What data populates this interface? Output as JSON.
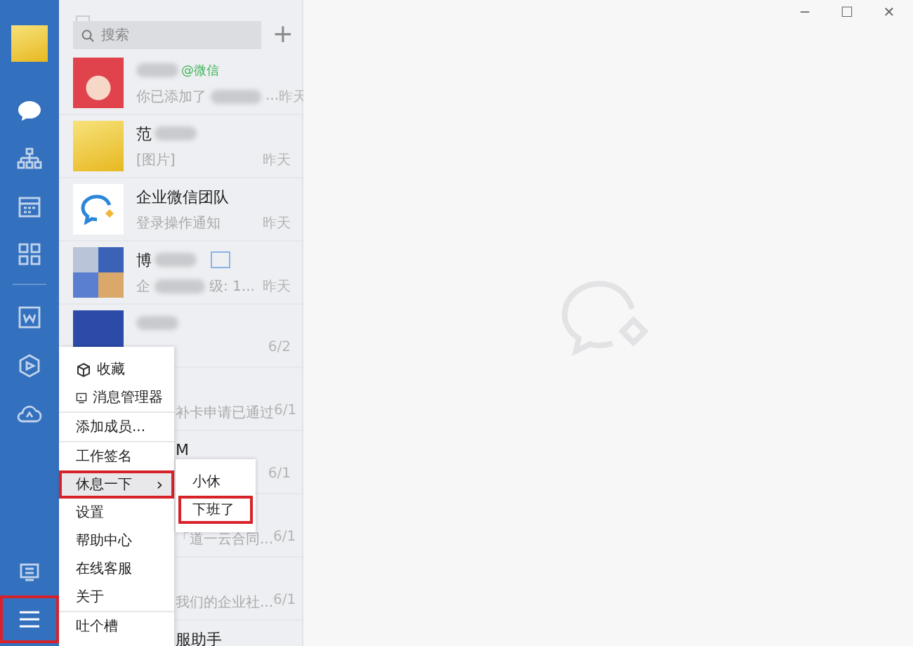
{
  "sidebar": {
    "items": [
      {
        "kind": "chat",
        "selected": true
      },
      {
        "kind": "org",
        "selected": false
      },
      {
        "kind": "calendar",
        "selected": false
      },
      {
        "kind": "apps",
        "selected": false
      },
      {
        "kind": "doc",
        "selected": false
      },
      {
        "kind": "hexagon",
        "selected": false
      },
      {
        "kind": "cloud",
        "selected": false
      }
    ],
    "bottom_items": [
      {
        "kind": "note",
        "highlighted": false
      },
      {
        "kind": "menu",
        "highlighted": true
      }
    ]
  },
  "search": {
    "placeholder": "搜索",
    "add_button": "+"
  },
  "chats": [
    {
      "kind": "cartoon",
      "name_blurred": true,
      "tag": "@微信",
      "preview": "你已添加了",
      "preview_blurred": true,
      "preview_end": "...",
      "time": "昨天"
    },
    {
      "kind": "sunny",
      "name": "范",
      "name_blurred": true,
      "preview": "[图片]",
      "time": "昨天"
    },
    {
      "kind": "logo",
      "name": "企业微信团队",
      "preview": "登录操作通知",
      "time": "昨天"
    },
    {
      "kind": "collage",
      "name": "博",
      "name_blurred": true,
      "badge": true,
      "preview": "企",
      "preview_blurred": true,
      "preview_end": "级: 1...",
      "time": "昨天"
    },
    {
      "kind": "navy",
      "name_blurred": true,
      "time": "6/2"
    },
    {
      "kind": "covered",
      "preview": "补卡申请已通过",
      "time": "6/1"
    },
    {
      "kind": "covered",
      "name": "M",
      "time": "6/1"
    },
    {
      "kind": "covered",
      "preview": "「道一云合同...",
      "time": "6/1"
    },
    {
      "kind": "covered",
      "preview": "我们的企业社...",
      "time": "6/1"
    },
    {
      "kind": "covered",
      "name": "服助手"
    }
  ],
  "menu": {
    "items": [
      {
        "kind": "cube-item",
        "label": "收藏",
        "hovered": false,
        "highlighted": false
      },
      {
        "kind": "monitor-item",
        "label": "消息管理器",
        "hovered": false,
        "highlighted": false
      },
      {
        "kind": "separator"
      },
      {
        "kind": "item",
        "label": "添加成员...",
        "hovered": false,
        "highlighted": false
      },
      {
        "kind": "separator"
      },
      {
        "kind": "item",
        "label": "工作签名",
        "hovered": false,
        "highlighted": false
      },
      {
        "kind": "submenu",
        "label": "休息一下",
        "arrow": "›",
        "hovered": true,
        "highlighted": true
      },
      {
        "kind": "item",
        "label": "设置",
        "hovered": false,
        "highlighted": false
      },
      {
        "kind": "item",
        "label": "帮助中心",
        "hovered": false,
        "highlighted": false
      },
      {
        "kind": "item",
        "label": "在线客服",
        "hovered": false,
        "highlighted": false
      },
      {
        "kind": "item",
        "label": "关于",
        "hovered": false,
        "highlighted": false
      },
      {
        "kind": "separator"
      },
      {
        "kind": "item",
        "label": "吐个槽",
        "hovered": false,
        "highlighted": false
      }
    ]
  },
  "submenu": {
    "items": [
      {
        "label": "小休",
        "highlighted": false
      },
      {
        "label": "下班了",
        "highlighted": true
      }
    ]
  },
  "window_controls": [
    "─",
    "☐",
    "✕"
  ]
}
